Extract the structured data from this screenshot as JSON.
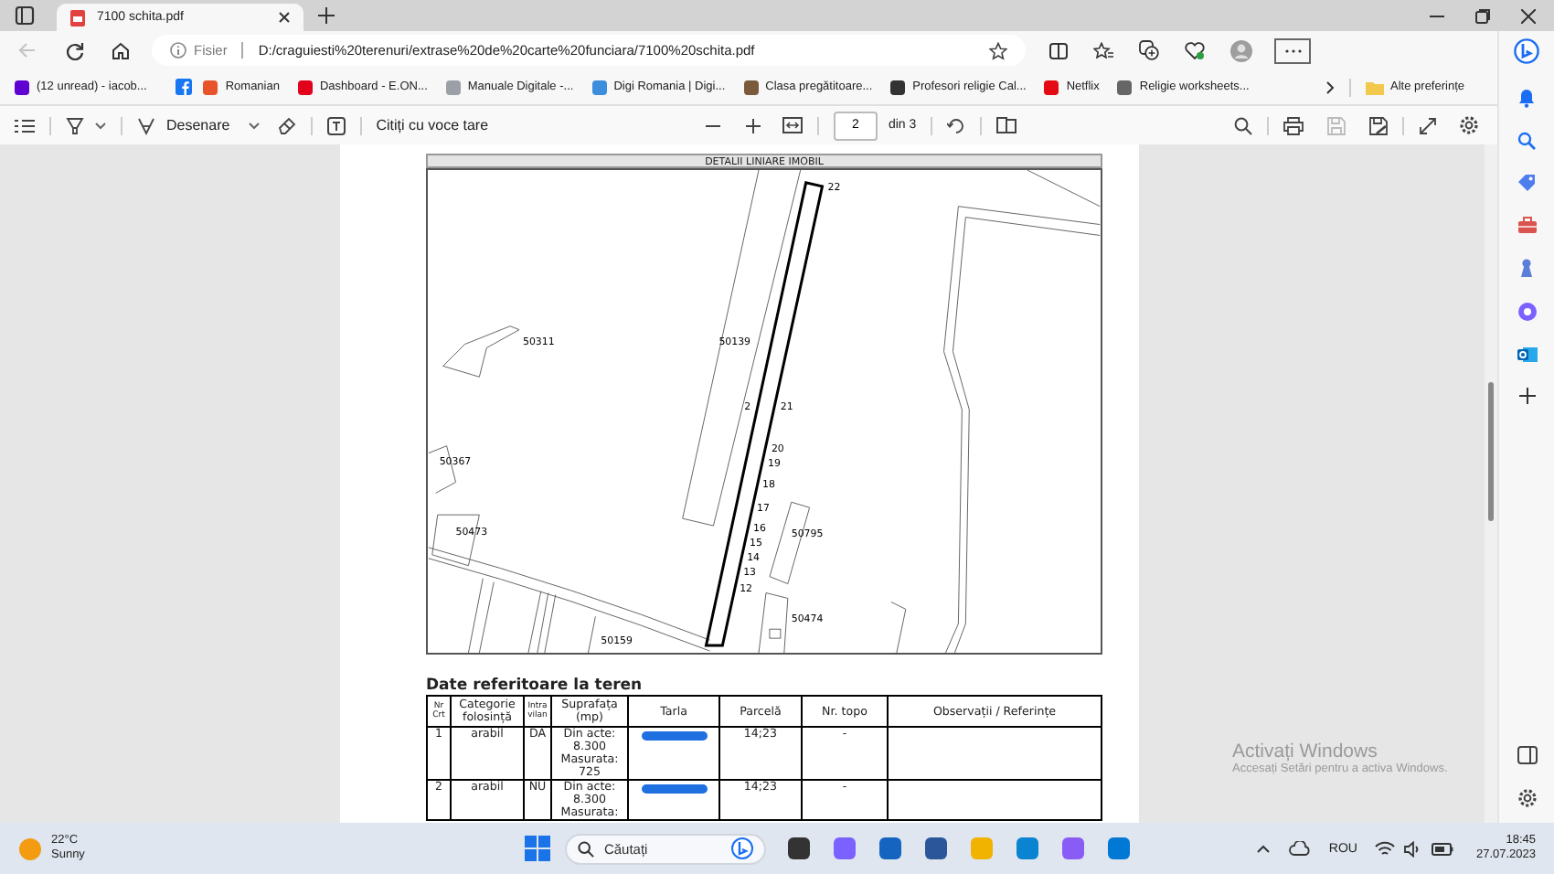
{
  "browser": {
    "tab": {
      "title": "7100 schita.pdf"
    },
    "address": {
      "prefix": "Fisier",
      "url": "D:/craguiesti%20terenuri/extrase%20de%20carte%20funciara/7100%20schita.pdf"
    },
    "bookmarks": [
      {
        "label": "(12 unread) - iacob...",
        "color": "#5f01d1"
      },
      {
        "label": "Romanian",
        "color": "#e8542a"
      },
      {
        "label": "Dashboard - E.ON...",
        "color": "#e3001b"
      },
      {
        "label": "Manuale Digitale -...",
        "color": "#9aa0a6"
      },
      {
        "label": "Digi Romania | Digi...",
        "color": "#3c8ddc"
      },
      {
        "label": "Clasa pregătitoare...",
        "color": "#7a5a3a"
      },
      {
        "label": "Profesori religie Cal...",
        "color": "#333333"
      },
      {
        "label": "Netflix",
        "color": "#e50914"
      },
      {
        "label": "Religie worksheets...",
        "color": "#666666"
      }
    ],
    "other_favorites": "Alte preferințe"
  },
  "pdf_toolbar": {
    "draw_label": "Desenare",
    "read_aloud": "Citiți cu voce tare",
    "page": "2",
    "page_count": "din 3"
  },
  "document": {
    "map": {
      "title": "DETALII LINIARE IMOBIL",
      "labels": [
        "50311",
        "50139",
        "50367",
        "50473",
        "50795",
        "50474",
        "50159",
        "22",
        "2",
        "21",
        "20",
        "19",
        "18",
        "17",
        "16",
        "15",
        "14",
        "13",
        "12"
      ]
    },
    "section_title": "Date referitoare la teren",
    "table": {
      "columns": [
        "Nr Crt",
        "Categorie folosință",
        "Intra vilan",
        "Suprafața (mp)",
        "Tarla",
        "Parcelă",
        "Nr. topo",
        "Observații / Referințe"
      ],
      "rows": [
        {
          "nr": "1",
          "category": "arabil",
          "intravilan": "DA",
          "area": "Din acte: 8.300 Masurata: 725",
          "parcel": "14;23",
          "topo": "-"
        },
        {
          "nr": "2",
          "category": "arabil",
          "intravilan": "NU",
          "area": "Din acte: 8.300 Masurata:",
          "parcel": "14;23",
          "topo": "-"
        }
      ]
    }
  },
  "activation": {
    "title": "Activați Windows",
    "subtitle": "Accesați Setări pentru a activa Windows."
  },
  "taskbar": {
    "weather": {
      "temp": "22°C",
      "condition": "Sunny"
    },
    "search_placeholder": "Căutați",
    "language": "ROU",
    "time": "18:45",
    "date": "27.07.2023"
  }
}
